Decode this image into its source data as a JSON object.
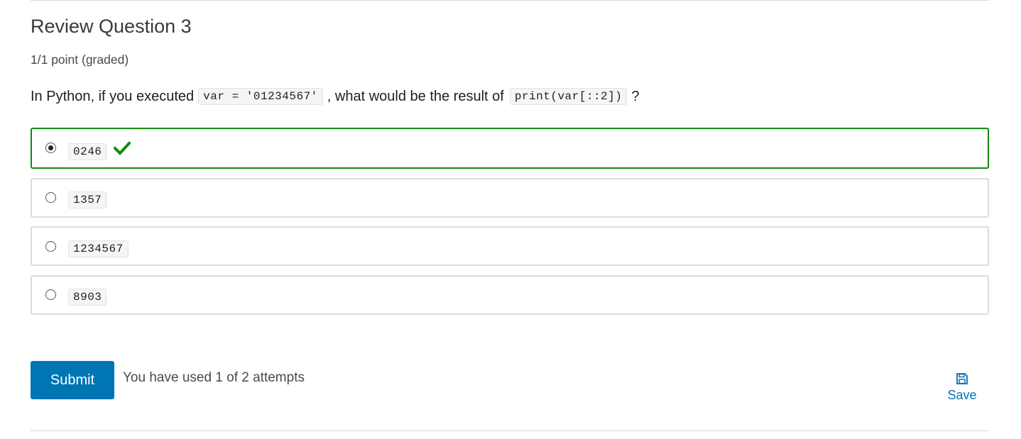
{
  "problem": {
    "title": "Review Question 3",
    "points": "1/1 point (graded)",
    "question": {
      "prefix": "In Python, if you executed",
      "code1": "var = '01234567'",
      "middle": ", what would be the result of",
      "code2": "print(var[::2])",
      "suffix": "?"
    },
    "choices": [
      {
        "label": "0246",
        "selected": true,
        "status": "correct"
      },
      {
        "label": "1357",
        "selected": false
      },
      {
        "label": "1234567",
        "selected": false
      },
      {
        "label": "8903",
        "selected": false
      }
    ],
    "status_icon": "checkmark-icon",
    "colors": {
      "correct": "#0f8a0f",
      "accent": "#0075b4"
    }
  },
  "actions": {
    "submit_label": "Submit",
    "attempts_text": "You have used 1 of 2 attempts",
    "save_label": "Save",
    "save_icon": "floppy-disk-icon"
  }
}
